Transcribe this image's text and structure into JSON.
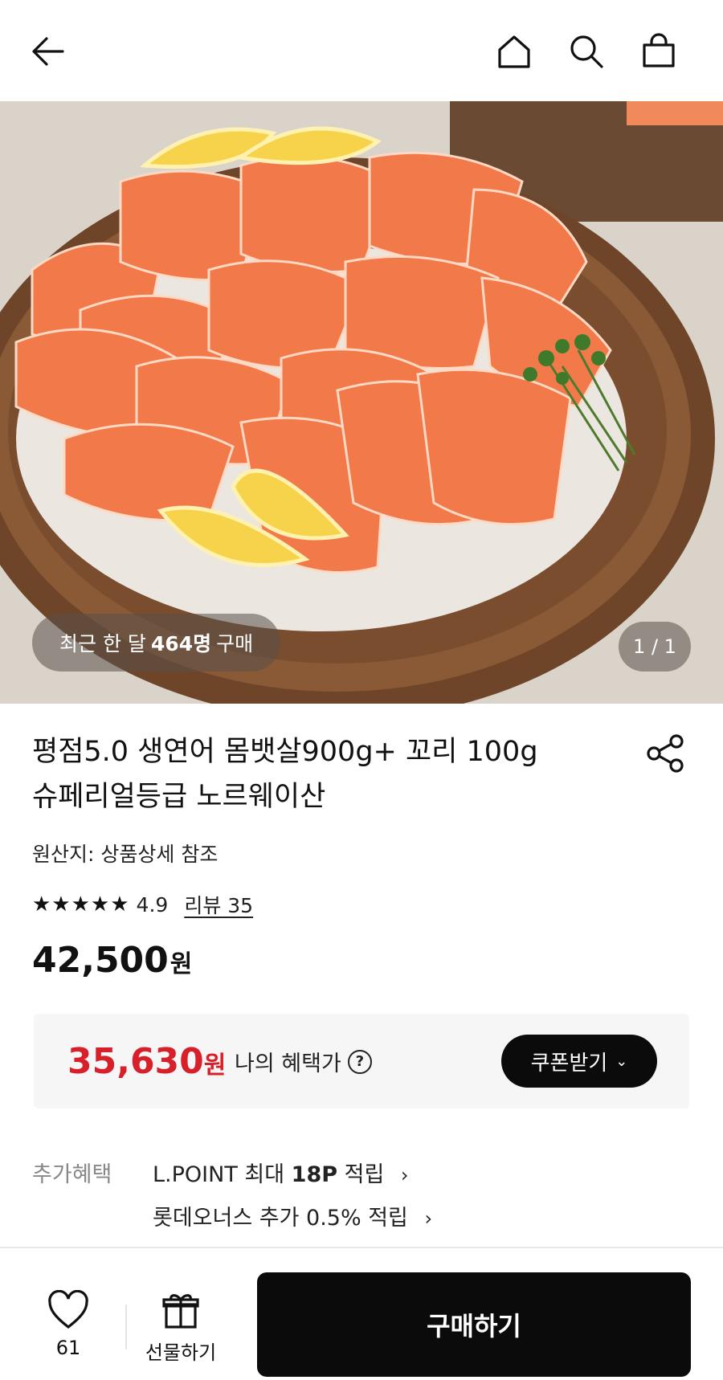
{
  "header": {
    "back_icon": "back-arrow-icon",
    "home_icon": "home-icon",
    "search_icon": "search-icon",
    "cart_icon": "shopping-bag-icon"
  },
  "hero": {
    "badge_prefix": "최근 한 달",
    "badge_count": "464명",
    "badge_suffix": "구매",
    "page_indicator": "1 / 1"
  },
  "product": {
    "title_line1": "평점5.0 생연어 몸뱃살900g+ 꼬리 100g",
    "title_line2": "슈페리얼등급 노르웨이산",
    "origin": "원산지: 상품상세 참조",
    "stars": "★★★★★",
    "rating_value": "4.9",
    "rating_fraction": 0.98,
    "review_link": "리뷰 35",
    "price": "42,500",
    "price_unit": "원"
  },
  "benefit": {
    "price": "35,630",
    "price_unit": "원",
    "label": "나의 혜택가",
    "coupon_button": "쿠폰받기"
  },
  "extra_benefits": {
    "label": "추가혜택",
    "items": [
      {
        "prefix": "L.POINT 최대",
        "bold": "18P",
        "suffix": "적립"
      },
      {
        "prefix": "롯데오너스 추가 0.5% 적립",
        "bold": "",
        "suffix": ""
      }
    ]
  },
  "bottom_bar": {
    "wish_count": "61",
    "gift_label": "선물하기",
    "buy_label": "구매하기"
  },
  "colors": {
    "accent_red": "#d8202a",
    "button_black": "#0b0b0b",
    "benefit_bg": "#f6f6f6"
  }
}
